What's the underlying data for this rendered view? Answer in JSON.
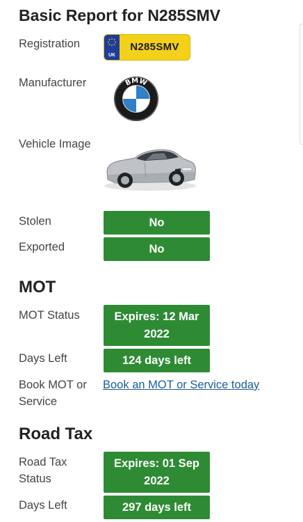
{
  "report": {
    "title": "Basic Report for N285SMV"
  },
  "basic": {
    "registration_label": "Registration",
    "plate": {
      "country": "UK",
      "number": "N285SMV"
    },
    "manufacturer_label": "Manufacturer",
    "manufacturer_logo": {
      "icon": "bmw-logo-icon",
      "text": "BMW"
    },
    "vehicle_image_label": "Vehicle Image",
    "vehicle_image_icon": "silver-convertible-car-image",
    "stolen_label": "Stolen",
    "stolen_value": "No",
    "exported_label": "Exported",
    "exported_value": "No"
  },
  "mot": {
    "heading": "MOT",
    "status_label": "MOT Status",
    "status_value": "Expires: 12 Mar 2022",
    "days_left_label": "Days Left",
    "days_left_value": "124 days left",
    "book_label": "Book MOT or Service",
    "book_link": "Book an MOT or Service today"
  },
  "road_tax": {
    "heading": "Road Tax",
    "status_label": "Road Tax Status",
    "status_value": "Expires: 01 Sep 2022",
    "days_left_label": "Days Left",
    "days_left_value": "297 days left"
  },
  "colors": {
    "status_green": "#2e8b34",
    "plate_yellow": "#f3d11a",
    "plate_blue": "#1f3c9a",
    "link_blue": "#1a5d9c"
  }
}
